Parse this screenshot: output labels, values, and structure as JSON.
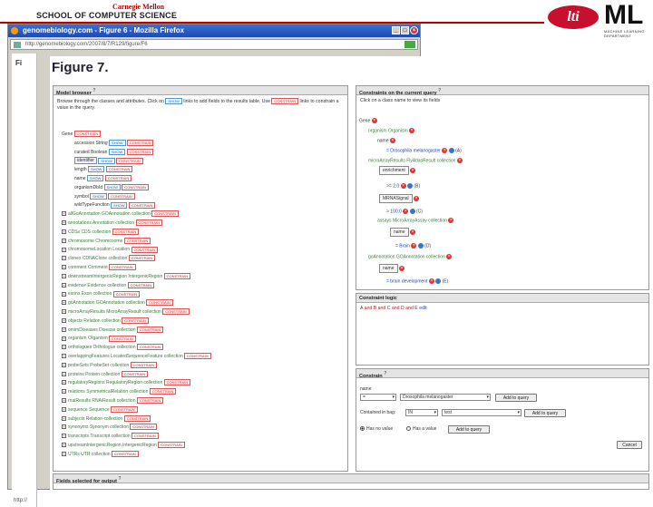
{
  "header": {
    "university": "Carnegie Mellon",
    "school": "SCHOOL OF COMPUTER SCIENCE",
    "lti_logo": "lti",
    "ml_logo": "ML",
    "ml_sub1": "MACHINE LEARNING",
    "ml_sub2": "DEPARTMENT"
  },
  "browser": {
    "title": "genomebiology.com - Figure 6 - Mozilla Firefox",
    "url": "http://genomebiology.com/2007/8/7/R129/figure/F6",
    "side_label": "Fi",
    "status": "http://"
  },
  "figure_title": "Figure 7.",
  "model_browser": {
    "title": "Model browser",
    "help": "?",
    "intro_1": "Browse through the classes and attributes. Click on",
    "intro_tag1": "SHOW",
    "intro_2": "links to add fields to the results table. Use",
    "intro_tag2": "CONSTRAIN",
    "intro_3": "links to constrain a value in the query.",
    "root": "Gene",
    "root_tag": "CONSTRAIN",
    "show": "SHOW",
    "constrain": "CONSTRAIN",
    "attributes": [
      "accession String",
      "curated Boolean",
      "identifier",
      "length",
      "name",
      "organismDbId",
      "symbol",
      "wildTypeFunction"
    ],
    "collections": [
      "allGoAnnotation GOAnnotation collection",
      "annotations Annotation collection",
      "CDSs CDS collection",
      "chromosome Chromosome",
      "chromosomeLocation Location",
      "clones CDNAClone collection",
      "comment Comment",
      "downstreamIntergenicRegion IntergenicRegion",
      "evidence Evidence collection",
      "exons Exon collection",
      "goAnnotation GOAnnotation collection",
      "microArrayResults MicroArrayResult collection",
      "objects Relation collection",
      "omimDiseases Disease collection",
      "organism Organism",
      "orthologues Orthologue collection",
      "overlappingFeatures LocatedSequenceFeature collection",
      "probeSets ProbeSet collection",
      "proteins Protein collection",
      "regulatoryRegions RegulatoryRegion collection",
      "relations SymmetricalRelation collection",
      "rnaiResults RNAiResult collection",
      "sequence Sequence",
      "subjects Relation collection",
      "synonyms Synonym collection",
      "transcripts Transcript collection",
      "upstreamIntergenicRegion IntergenicRegion",
      "UTRs UTR collection"
    ]
  },
  "constraints": {
    "title": "Constraints on the current query",
    "help": "?",
    "intro": "Click on a class name to view its fields",
    "nodes": {
      "gene": "Gene",
      "organism": "organism Organism",
      "name": "name",
      "name_val": "= Drosophila melanogaster",
      "name_code": "(A)",
      "micro": "microArrayResults FlyAtlasResult collection",
      "enrichment": "enrichment",
      "enrich_val": ">= 2.0",
      "enrich_code": "(B)",
      "mrna": "MRNASignal",
      "mrna_val": "> 100.0",
      "mrna_code": "(C)",
      "assays": "assays MicroArrayAssay collection",
      "assay_name": "name",
      "assay_val": "= Brain",
      "assay_code": "(D)",
      "go": "goAnnotation GOAnnotation collection",
      "go_name": "name",
      "go_val": "= brain development",
      "go_code": "(E)"
    }
  },
  "logic": {
    "title": "Constraint logic",
    "expr": "A and B and C and D and E",
    "edit": "edit"
  },
  "constrain": {
    "title": "Constrain",
    "help": "?",
    "field": "name",
    "op": "=",
    "value": "Drosophila melanogaster",
    "add1": "Add to query",
    "bag_label": "Contained in bag:",
    "bag_op": "IN",
    "bag_value": "test",
    "add2": "Add to query",
    "opt1": "Has no value",
    "opt2": "Has a value",
    "add3": "Add to query",
    "cancel": "Cancel"
  },
  "fields_panel": {
    "title": "Fields selected for output",
    "help": "?"
  }
}
